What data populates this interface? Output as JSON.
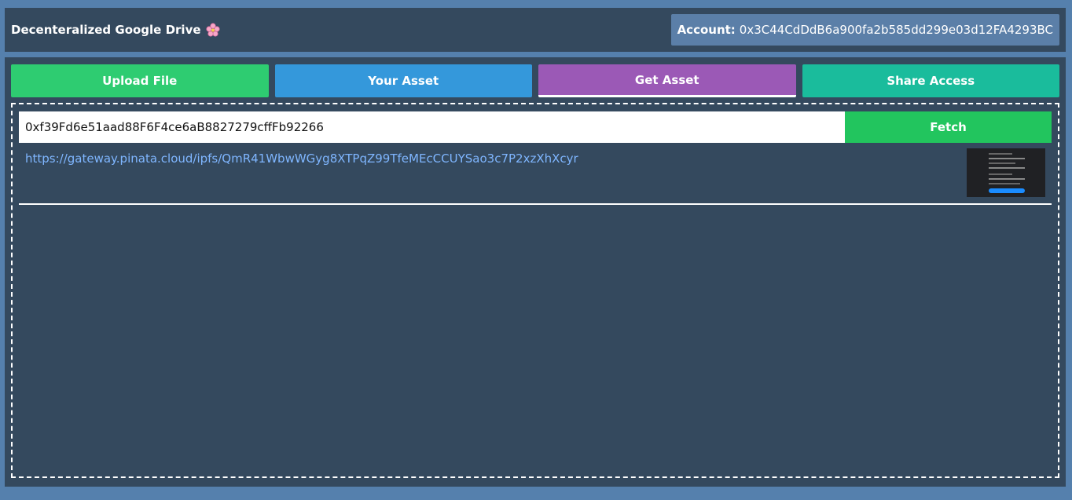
{
  "header": {
    "title": "Decenteralized Google Drive",
    "account_label": "Account:",
    "account_address": "0x3C44CdDdB6a900fa2b585dd299e03d12FA4293BC"
  },
  "tabs": [
    {
      "label": "Upload File",
      "color": "#2ecc71"
    },
    {
      "label": "Your Asset",
      "color": "#3498db"
    },
    {
      "label": "Get Asset",
      "color": "#9b59b6",
      "active": true
    },
    {
      "label": "Share Access",
      "color": "#1abc9c"
    }
  ],
  "get_asset": {
    "address_value": "0xf39Fd6e51aad88F6F4ce6aB8827279cffFb92266",
    "fetch_label": "Fetch",
    "results": [
      {
        "url": "https://gateway.pinata.cloud/ipfs/QmR41WbwWGyg8XTPqZ99TfeMEcCCUYSao3c7P2xzXhXcyr"
      }
    ]
  }
}
